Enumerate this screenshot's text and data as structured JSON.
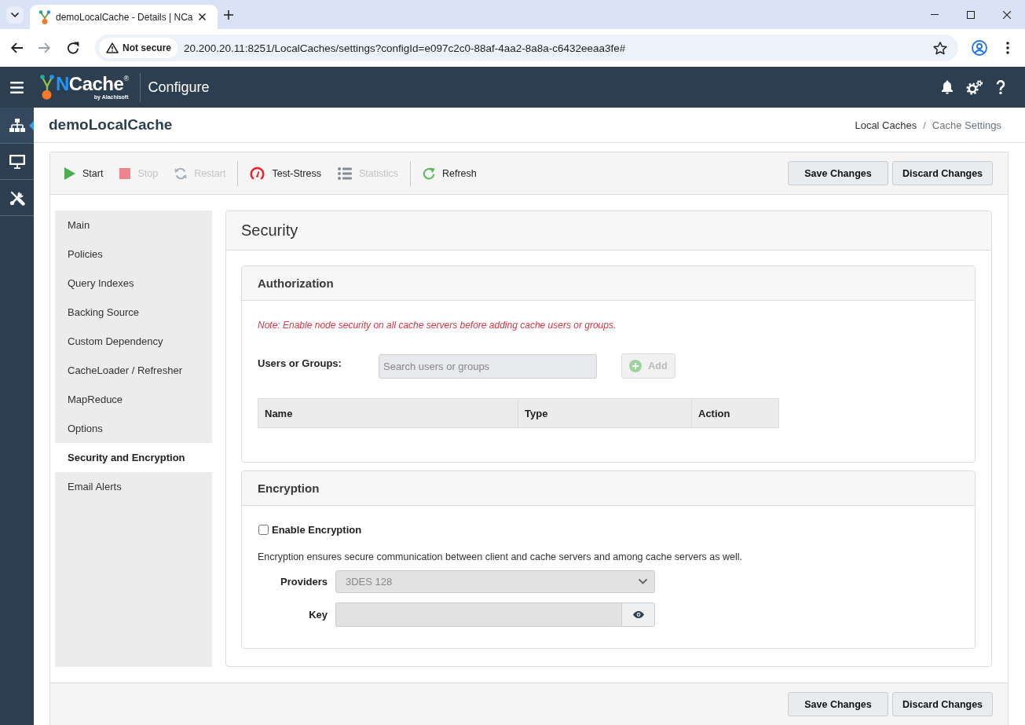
{
  "browser": {
    "tab_title": "demoLocalCache - Details | NCa",
    "security_chip": "Not secure",
    "url": "20.200.20.11:8251/LocalCaches/settings?configId=e097c2c0-88af-4aa2-8a8a-c6432eeaa3fe#"
  },
  "app_header": {
    "product": "NCache$^{®}$",
    "vendor": "by Alachisoft",
    "section": "Configure"
  },
  "rail": [
    {
      "kind": "hierarchy",
      "selected": true
    },
    {
      "kind": "monitor",
      "selected": false
    },
    {
      "kind": "tools",
      "selected": false
    }
  ],
  "page": {
    "title": "demoLocalCache",
    "breadcrumb": {
      "separator": "/",
      "items": [
        {
          "label": "Local Caches",
          "current": false
        },
        {
          "label": "Cache Settings",
          "current": true
        }
      ]
    }
  },
  "toolbar": {
    "groups": [
      {
        "actions": [
          {
            "kind": "play",
            "label": "Start",
            "disabled": false
          },
          {
            "kind": "stop",
            "label": "Stop",
            "disabled": true
          },
          {
            "kind": "restart",
            "label": "Restart",
            "disabled": true
          }
        ]
      },
      {
        "actions": [
          {
            "kind": "gauge",
            "label": "Test-Stress",
            "disabled": false
          },
          {
            "kind": "list",
            "label": "Statistics",
            "disabled": true
          }
        ]
      },
      {
        "actions": [
          {
            "kind": "refresh",
            "label": "Refresh",
            "disabled": false
          }
        ]
      }
    ],
    "buttons": [
      "Save Changes",
      "Discard Changes"
    ]
  },
  "nav": [
    {
      "label": "Main",
      "selected": false
    },
    {
      "label": "Policies",
      "selected": false
    },
    {
      "label": "Query Indexes",
      "selected": false
    },
    {
      "label": "Backing Source",
      "selected": false
    },
    {
      "label": "Custom Dependency",
      "selected": false
    },
    {
      "label": "CacheLoader / Refresher",
      "selected": false
    },
    {
      "label": "MapReduce",
      "selected": false
    },
    {
      "label": "Options",
      "selected": false
    },
    {
      "label": "Security and Encryption",
      "selected": true
    },
    {
      "label": "Email Alerts",
      "selected": false
    }
  ],
  "panel": {
    "title": "Security",
    "authorization": {
      "title": "Authorization",
      "note": "Note: Enable node security on all cache servers before adding cache users or groups.",
      "users_label": "Users or Groups:",
      "search": {
        "placeholder": "Search users or groups",
        "disabled": true
      },
      "add_button": {
        "label": "Add",
        "disabled": true
      },
      "table": {
        "columns": [
          "Name",
          "Type",
          "Action"
        ]
      }
    },
    "encryption": {
      "title": "Encryption",
      "enable": {
        "label": "Enable Encryption",
        "checked": false
      },
      "description": "Encryption ensures secure communication between client and cache servers and among cache servers as well.",
      "providers": {
        "label": "Providers",
        "value": "3DES 128",
        "disabled": true
      },
      "key": {
        "label": "Key",
        "disabled": true
      }
    }
  },
  "footer": {
    "buttons": [
      "Save Changes",
      "Discard Changes"
    ]
  }
}
